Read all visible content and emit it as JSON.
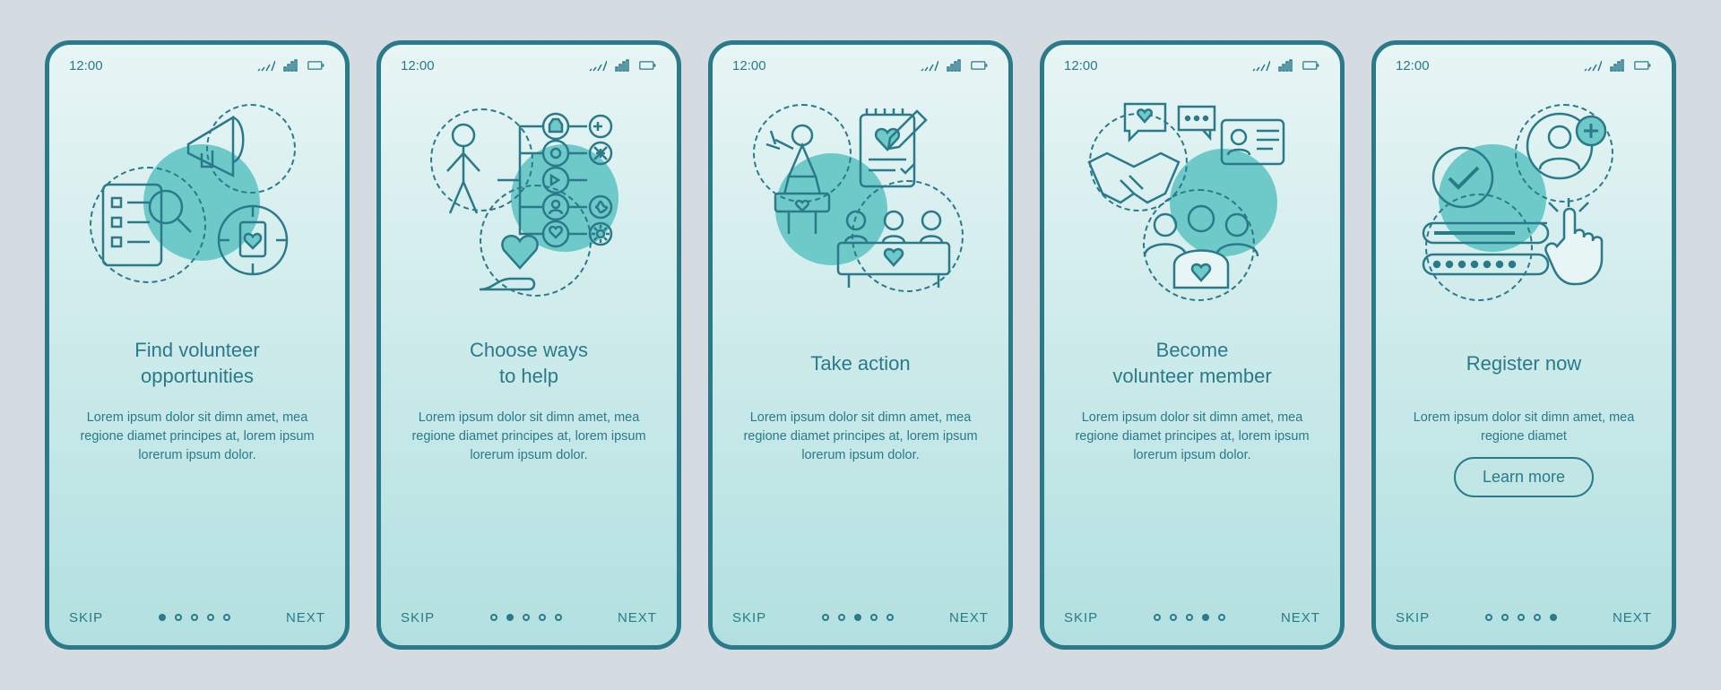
{
  "status": {
    "time": "12:00",
    "icons": [
      "signal-icon",
      "network-icon",
      "battery-icon"
    ]
  },
  "nav": {
    "skip": "SKIP",
    "next": "NEXT"
  },
  "screens": [
    {
      "icon": "megaphone-search-icon",
      "title_l1": "Find volunteer",
      "title_l2": "opportunities",
      "body": "Lorem ipsum dolor sit dimn amet, mea regione diamet principes at, lorem ipsum lorerum ipsum dolor.",
      "active_dot": 0,
      "cta": null
    },
    {
      "icon": "choose-help-icon",
      "title_l1": "Choose ways",
      "title_l2": "to help",
      "body": "Lorem ipsum dolor sit dimn amet, mea regione diamet principes at, lorem ipsum lorerum ipsum dolor.",
      "active_dot": 1,
      "cta": null
    },
    {
      "icon": "take-action-icon",
      "title_l1": "Take action",
      "title_l2": "",
      "body": "Lorem ipsum dolor sit dimn amet, mea regione diamet principes at, lorem ipsum lorerum ipsum dolor.",
      "active_dot": 2,
      "cta": null
    },
    {
      "icon": "member-icon",
      "title_l1": "Become",
      "title_l2": "volunteer member",
      "body": "Lorem ipsum dolor sit dimn amet, mea regione diamet principes at, lorem ipsum lorerum ipsum dolor.",
      "active_dot": 3,
      "cta": null
    },
    {
      "icon": "register-icon",
      "title_l1": "Register now",
      "title_l2": "",
      "body": "Lorem ipsum dolor sit dimn amet, mea regione diamet",
      "active_dot": 4,
      "cta": "Learn more"
    }
  ]
}
